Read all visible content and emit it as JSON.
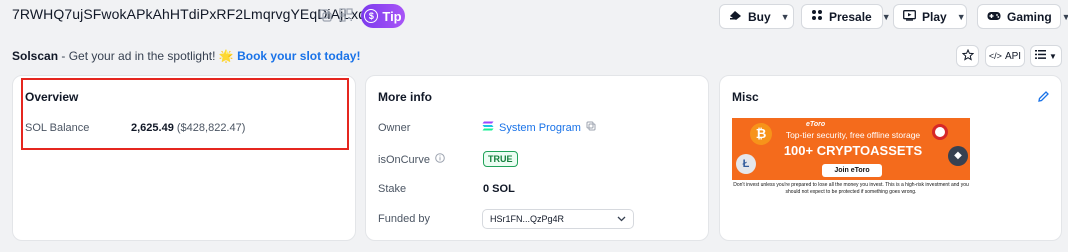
{
  "header": {
    "address": "7RWHQ7ujSFwokAPkAhHTdiPxRF2LmqrvgYEqDiAjLxdH",
    "tip_label": "Tip",
    "menus": [
      {
        "label": "Buy",
        "icon": "buy-icon"
      },
      {
        "label": "Presale",
        "icon": "presale-icon"
      },
      {
        "label": "Play",
        "icon": "play-icon"
      },
      {
        "label": "Gaming",
        "icon": "gamepad-icon"
      }
    ]
  },
  "ad": {
    "brand": "Solscan",
    "text": " - Get your ad in the spotlight! ",
    "emoji": "🌟",
    "link": "Book your slot today!"
  },
  "tools": {
    "api_label": "API"
  },
  "overview": {
    "title": "Overview",
    "sol_balance_label": "SOL Balance",
    "sol_balance_value": "2,625.49",
    "sol_balance_usd": "($428,822.47)"
  },
  "more_info": {
    "title": "More info",
    "owner_label": "Owner",
    "owner_value": "System Program",
    "is_on_curve_label": "isOnCurve",
    "is_on_curve_value": "TRUE",
    "stake_label": "Stake",
    "stake_value": "0 SOL",
    "funded_by_label": "Funded by",
    "funded_by_value": "HSr1FN...QzPg4R"
  },
  "misc": {
    "title": "Misc",
    "banner": {
      "brand": "eToro",
      "headline": "Top-tier security, free offline storage",
      "big": "100+ CRYPTOASSETS",
      "cta": "Join eToro",
      "disclaimer": "Don't invest unless you're prepared to lose all the money you invest. This is a high-risk investment and you should not expect to be protected if something goes wrong."
    }
  },
  "colors": {
    "accent_link": "#1a73e8",
    "tip_gradient_start": "#7c3aed",
    "highlight_box": "#e5261f",
    "true_badge": "#22a35a",
    "banner_orange": "#f46b1c"
  }
}
